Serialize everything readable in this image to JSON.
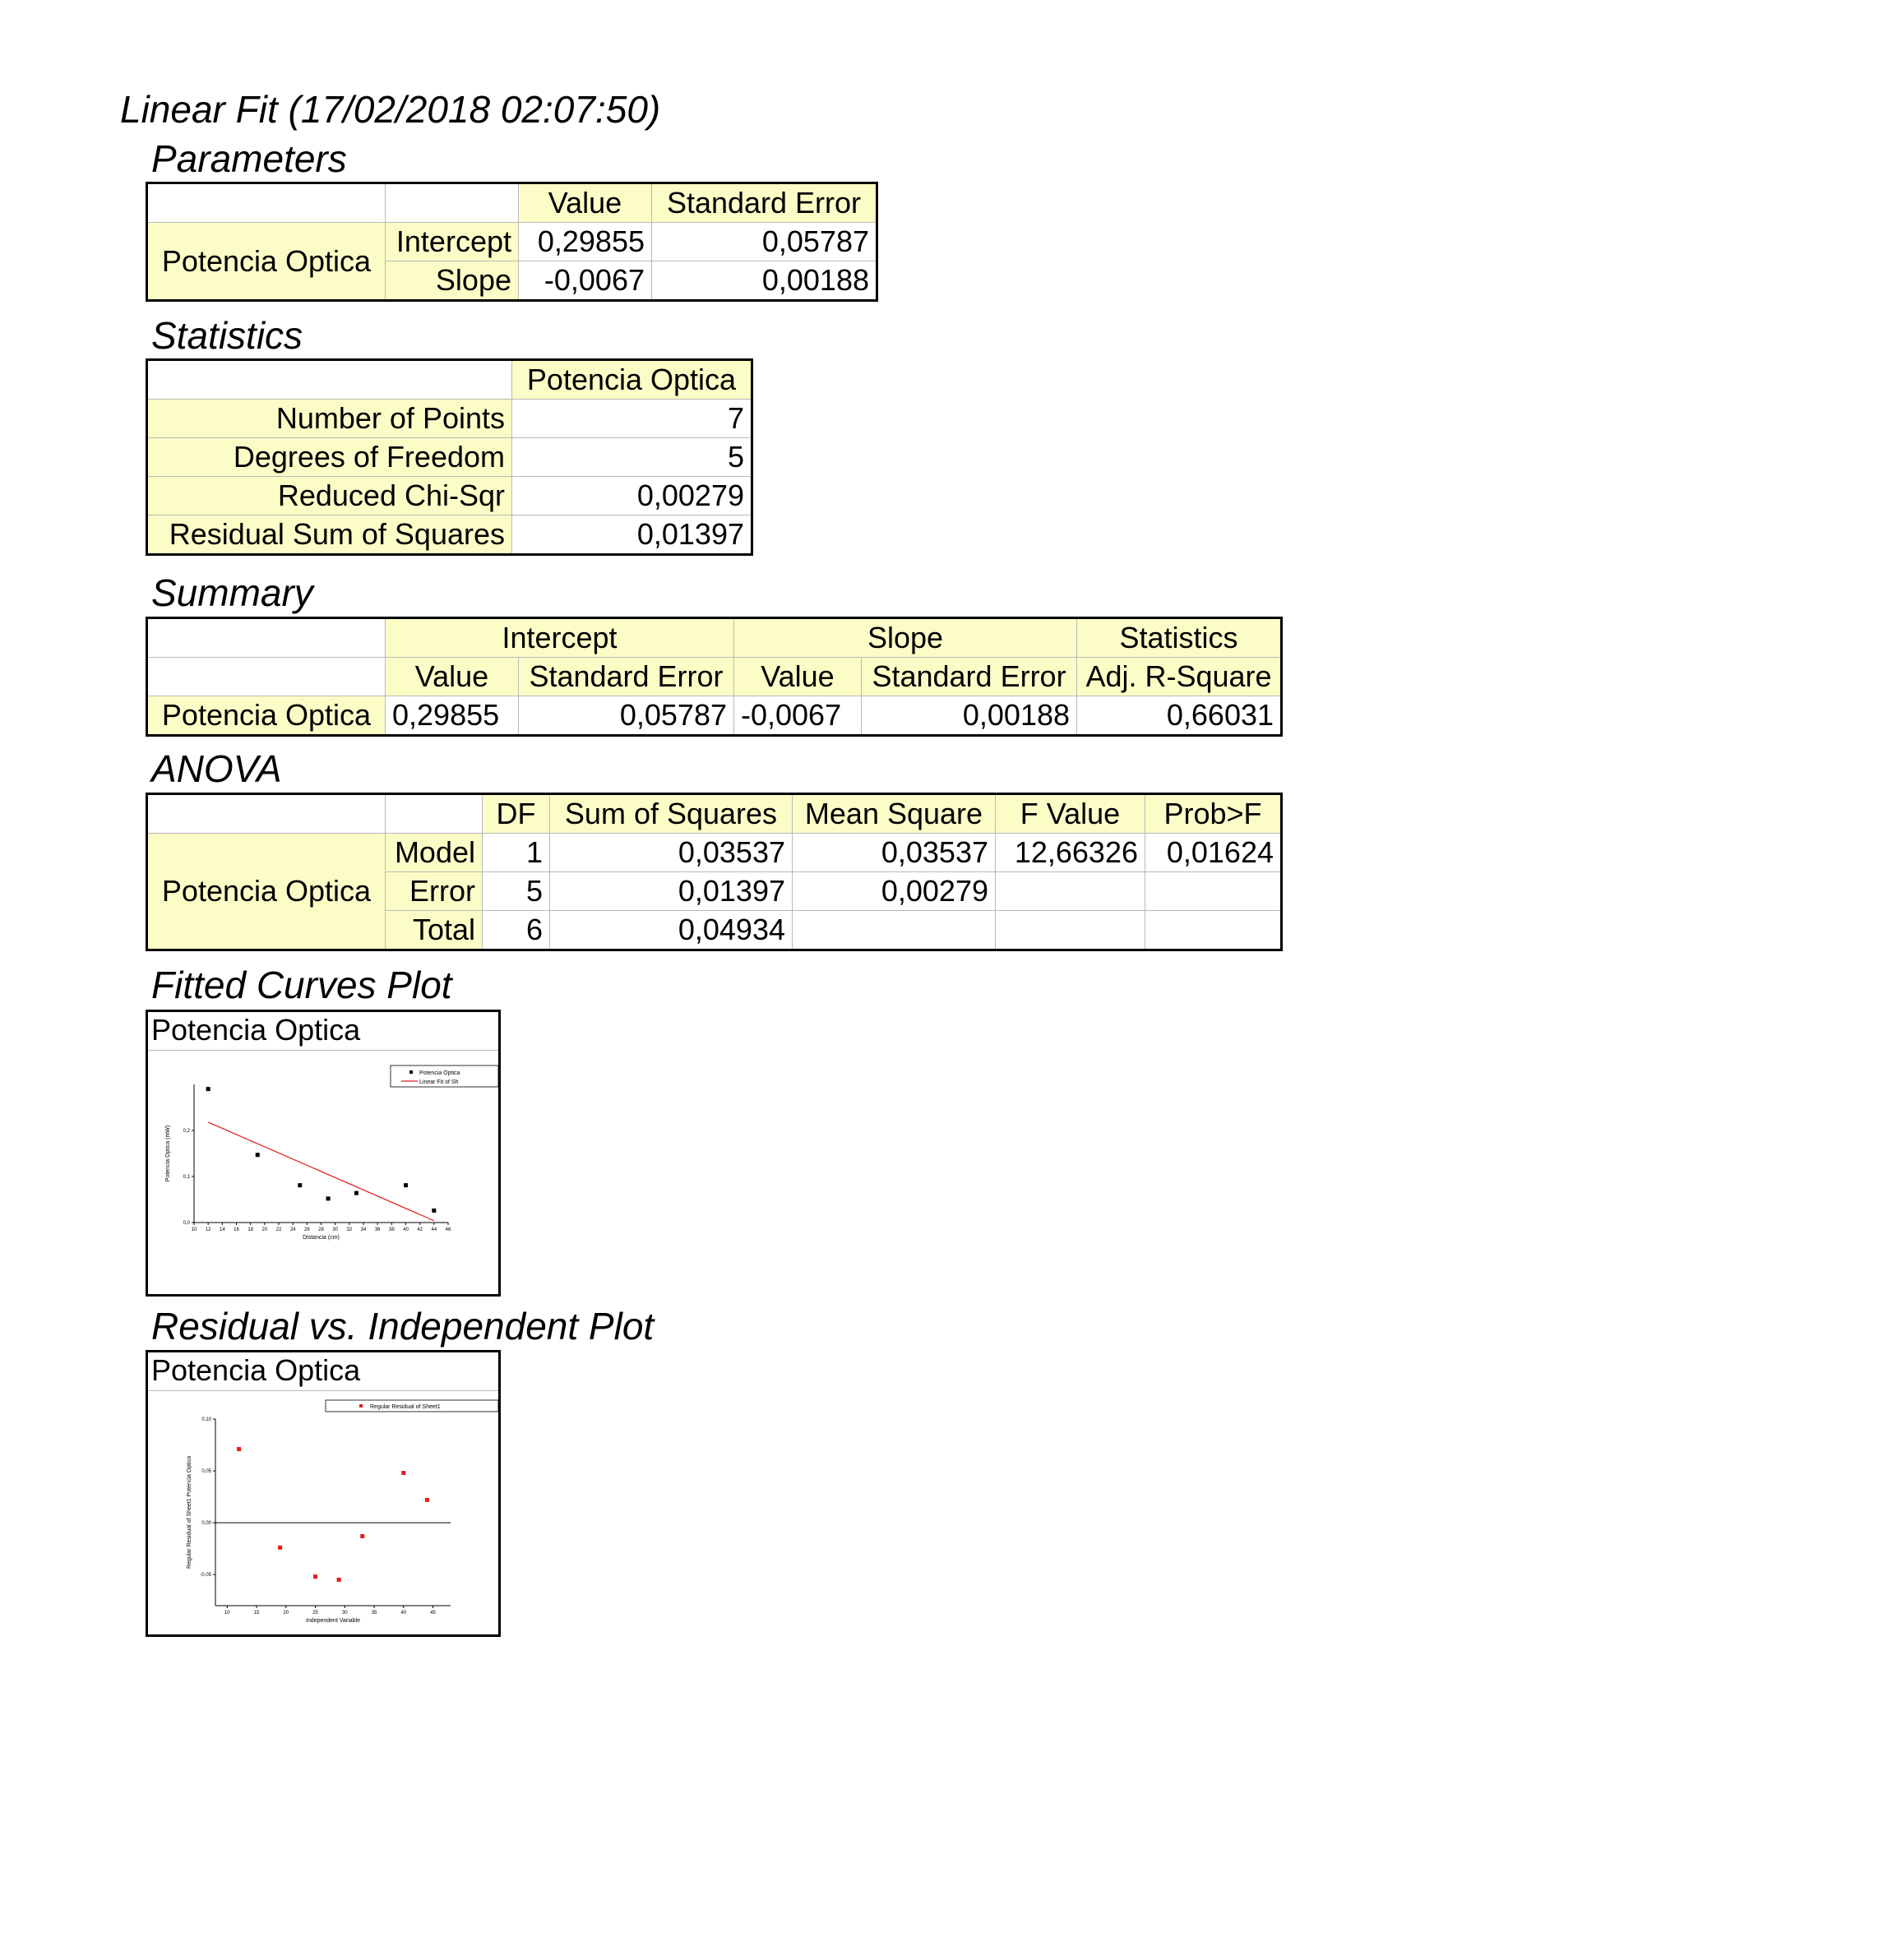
{
  "report_title": "Linear Fit (17/02/2018 02:07:50)",
  "parameters": {
    "heading": "Parameters",
    "col_value": "Value",
    "col_std_err": "Standard Error",
    "group": "Potencia Optica",
    "rows": [
      {
        "name": "Intercept",
        "value": "0,29855",
        "std_err": "0,05787"
      },
      {
        "name": "Slope",
        "value": "-0,0067",
        "std_err": "0,00188"
      }
    ]
  },
  "statistics": {
    "heading": "Statistics",
    "col": "Potencia Optica",
    "rows": [
      {
        "name": "Number of Points",
        "value": "7"
      },
      {
        "name": "Degrees of Freedom",
        "value": "5"
      },
      {
        "name": "Reduced Chi-Sqr",
        "value": "0,00279"
      },
      {
        "name": "Residual Sum of Squares",
        "value": "0,01397"
      }
    ]
  },
  "summary": {
    "heading": "Summary",
    "grp_intercept": "Intercept",
    "grp_slope": "Slope",
    "grp_statistics": "Statistics",
    "col_value": "Value",
    "col_std_err": "Standard Error",
    "col_adj_r2": "Adj. R-Square",
    "row_name": "Potencia Optica",
    "intercept_value": "0,29855",
    "intercept_std_err": "0,05787",
    "slope_value": "-0,0067",
    "slope_std_err": "0,00188",
    "adj_r2": "0,66031"
  },
  "anova": {
    "heading": "ANOVA",
    "cols": {
      "df": "DF",
      "ss": "Sum of Squares",
      "ms": "Mean Square",
      "f": "F Value",
      "p": "Prob>F"
    },
    "group": "Potencia Optica",
    "rows": [
      {
        "name": "Model",
        "df": "1",
        "ss": "0,03537",
        "ms": "0,03537",
        "f": "12,66326",
        "p": "0,01624"
      },
      {
        "name": "Error",
        "df": "5",
        "ss": "0,01397",
        "ms": "0,00279",
        "f": "",
        "p": ""
      },
      {
        "name": "Total",
        "df": "6",
        "ss": "0,04934",
        "ms": "",
        "f": "",
        "p": ""
      }
    ]
  },
  "fitted_plot": {
    "heading": "Fitted Curves Plot",
    "caption": "Potencia Optica",
    "legend": [
      "Potencia Optica",
      "Linear Fit of Sh"
    ]
  },
  "residual_plot": {
    "heading": "Residual vs. Independent Plot",
    "caption": "Potencia Optica",
    "legend": [
      "Regular Residual of Sheet1"
    ]
  },
  "colors": {
    "header_bg": "#fcfcc6",
    "fit_line": "#e41a1c",
    "residual_marker": "#e41a1c",
    "data_marker": "#000000"
  },
  "chart_data": [
    {
      "type": "scatter",
      "title": "",
      "xlabel": "Distancia (cm)",
      "ylabel": "Potencia Optica (mW)",
      "xlim": [
        10,
        46
      ],
      "ylim": [
        0.0,
        0.3
      ],
      "xticks": [
        "10",
        "12",
        "14",
        "16",
        "18",
        "20",
        "22",
        "24",
        "26",
        "28",
        "30",
        "32",
        "34",
        "36",
        "38",
        "40",
        "42",
        "44",
        "46"
      ],
      "yticks": [
        "0,0",
        "0,1",
        "0,2"
      ],
      "series": [
        {
          "name": "Potencia Optica",
          "kind": "points",
          "x": [
            12,
            19,
            25,
            29,
            33,
            40,
            44
          ],
          "y": [
            0.29,
            0.147,
            0.081,
            0.052,
            0.064,
            0.081,
            0.026
          ]
        },
        {
          "name": "Linear Fit of Sh",
          "kind": "line",
          "x": [
            12,
            44
          ],
          "y": [
            0.218,
            0.004
          ]
        }
      ],
      "legend": "top-right",
      "grid": false
    },
    {
      "type": "scatter",
      "title": "",
      "xlabel": "Independent Variable",
      "ylabel": "Regular Residual of Sheet1 Potencia Optica",
      "xlim": [
        8,
        48
      ],
      "ylim": [
        -0.08,
        0.1
      ],
      "xticks": [
        "10",
        "15",
        "20",
        "25",
        "30",
        "35",
        "40",
        "45"
      ],
      "yticks": [
        "-0,05",
        "0,00",
        "0,05",
        "0,10"
      ],
      "series": [
        {
          "name": "Regular Residual of Sheet1",
          "x": [
            12,
            19,
            25,
            29,
            33,
            40,
            44
          ],
          "y": [
            0.071,
            -0.024,
            -0.052,
            -0.055,
            -0.013,
            0.048,
            0.022
          ]
        }
      ],
      "zero_line": true,
      "legend": "top-right",
      "grid": false
    }
  ]
}
